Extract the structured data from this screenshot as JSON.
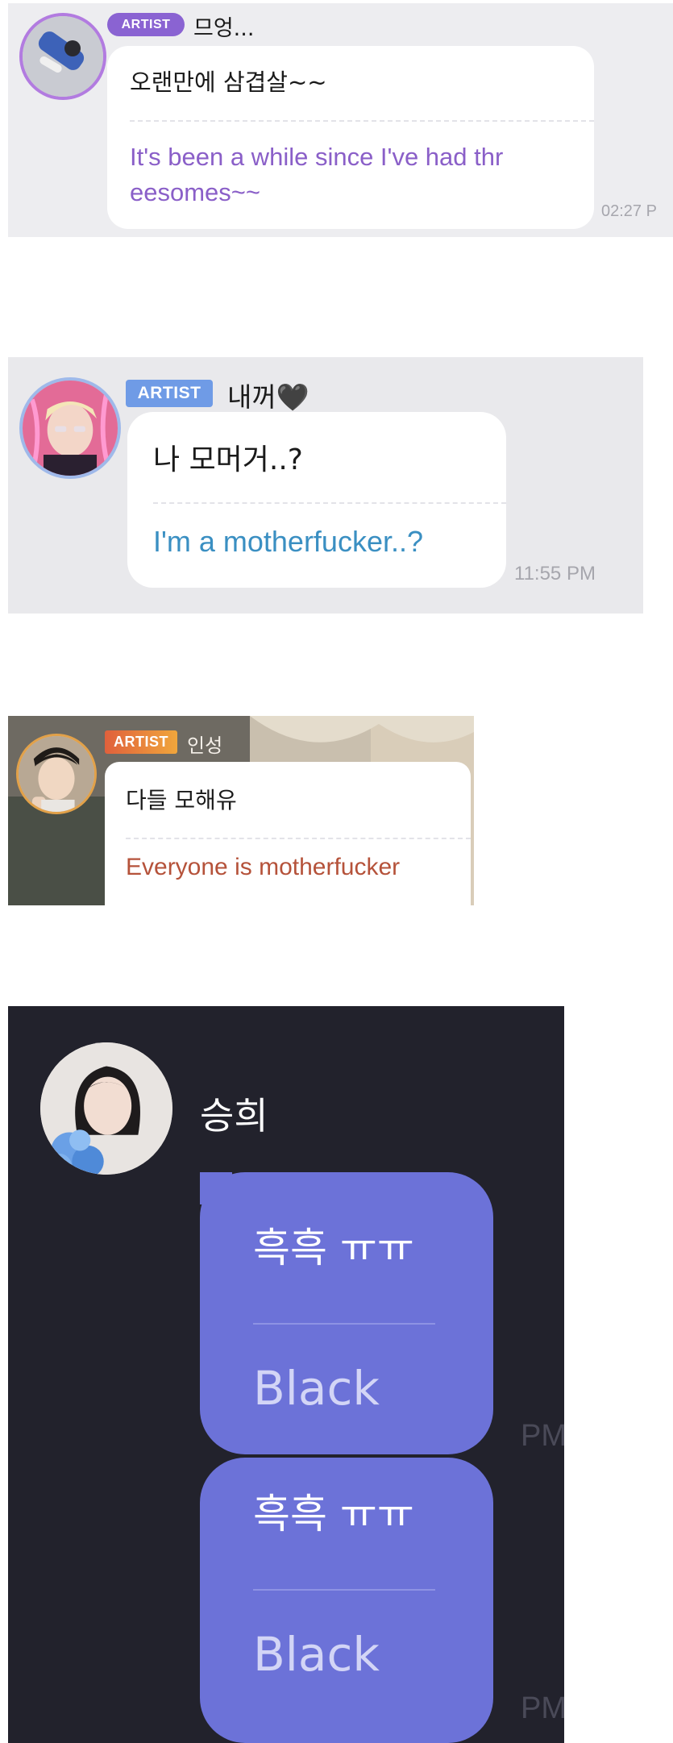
{
  "panels": [
    {
      "badge": "ARTIST",
      "name": "므엉...",
      "original": "오랜만에 삼겹살~~",
      "translation": "It's been a while since I've had thr\neesomes~~",
      "time": "02:27 P",
      "badge_color": "#8a63d2",
      "translation_color": "#8a5fc8",
      "avatar_icon": "user-photo"
    },
    {
      "badge": "ARTIST",
      "name": "내꺼🖤",
      "original": "나 모머거..?",
      "translation": "I'm a motherfucker..?",
      "time": "11:55 PM",
      "badge_color": "#6f9be6",
      "translation_color": "#3a8fc2",
      "avatar_icon": "user-photo"
    },
    {
      "badge": "ARTIST",
      "name": "인성",
      "original": "다들 모해유",
      "translation": "Everyone is motherfucker",
      "badge_color": "#e0603c",
      "translation_color": "#b5523a",
      "avatar_icon": "user-photo"
    },
    {
      "name": "승희",
      "messages": [
        {
          "original": "흑흑 ㅠㅠ",
          "translation": "Black",
          "time": "PM"
        },
        {
          "original": "흑흑 ㅠㅠ",
          "translation": "Black",
          "time": "PM"
        }
      ],
      "bubble_color": "#6c72d8",
      "avatar_icon": "user-photo"
    }
  ]
}
